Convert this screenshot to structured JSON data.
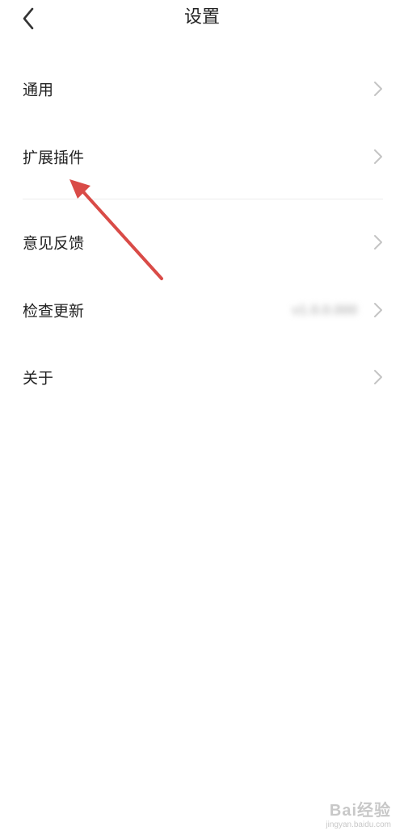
{
  "header": {
    "title": "设置",
    "back_icon": "chevron-left-icon"
  },
  "rows": [
    {
      "label": "通用"
    },
    {
      "label": "扩展插件"
    },
    {
      "label": "意见反馈"
    },
    {
      "label": "检查更新",
      "value": "v1.0.0.000"
    },
    {
      "label": "关于"
    }
  ],
  "watermark": {
    "logo": "Bai经验",
    "url": "jingyan.baidu.com"
  },
  "colors": {
    "text": "#222222",
    "chevron": "#c4c4c4",
    "divider": "#ececec",
    "arrow": "#d94b47"
  }
}
